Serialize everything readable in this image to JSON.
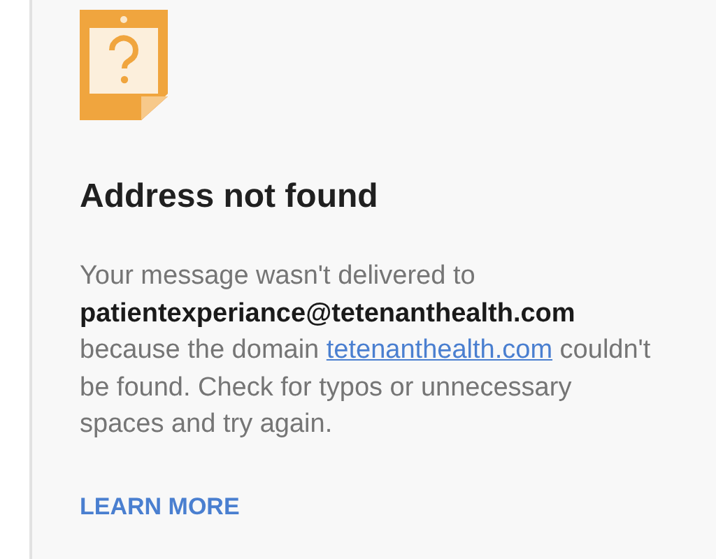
{
  "title": "Address not found",
  "message": {
    "before": "Your message wasn't delivered to **patientexperiance@tetenanthealth.com** because the domain",
    "link": "tetenanthealth.com",
    "after": "couldn't be found. Check for typos or unnecessary spaces and try again."
  },
  "learn_more": "LEARN MORE"
}
